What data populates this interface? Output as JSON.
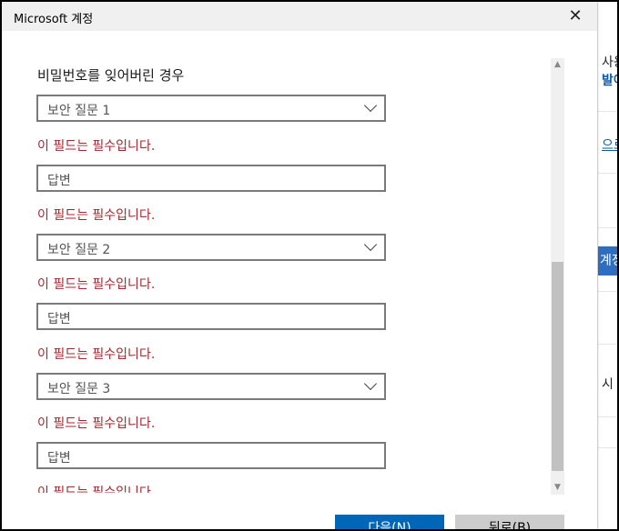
{
  "window": {
    "title": "Microsoft 계정"
  },
  "form": {
    "heading": "비밀번호를 잊어버린 경우",
    "error_text": "이 필드는 필수입니다.",
    "question1": "보안 질문 1",
    "answer1_placeholder": "답변",
    "question2": "보안 질문 2",
    "answer2_placeholder": "답변",
    "question3": "보안 질문 3",
    "answer3_placeholder": "답변"
  },
  "buttons": {
    "next": "다음(N)",
    "back": "뒤로(B)"
  },
  "background_app": {
    "text1": "사용",
    "text2": "발아",
    "text3": "으로",
    "button": "계정",
    "text4": "시"
  },
  "colors": {
    "error": "#a4262c",
    "primary_button": "#0067b8",
    "secondary_button": "#cccccc"
  }
}
